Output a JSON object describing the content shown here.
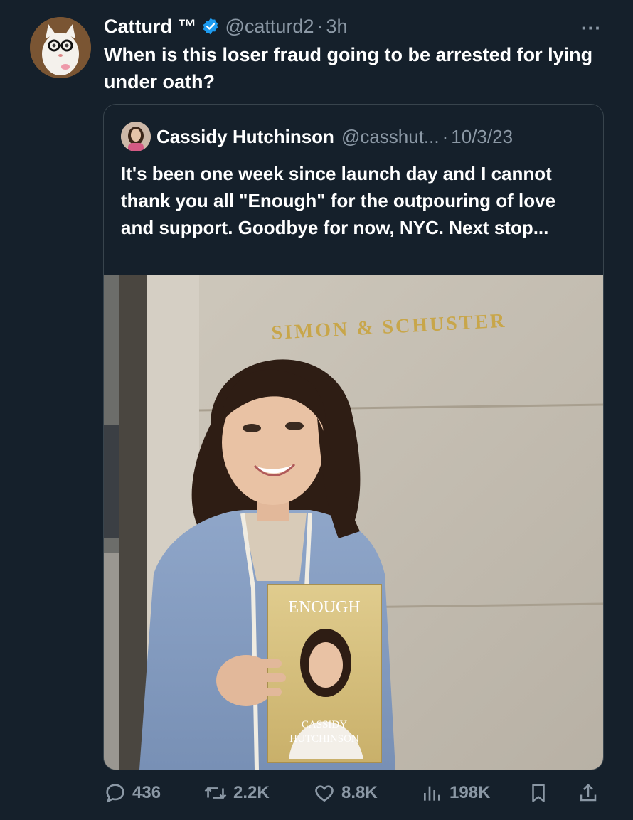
{
  "tweet": {
    "author": {
      "display_name": "Catturd ™",
      "handle": "@catturd2",
      "separator": "·",
      "time": "3h"
    },
    "text": "When is this loser fraud going to be arrested for lying under oath?",
    "more_label": "···"
  },
  "quote": {
    "author": {
      "display_name": "Cassidy Hutchinson",
      "handle": "@casshut...",
      "separator": "·",
      "time": "10/3/23"
    },
    "text": "It's been one week since launch day and I cannot thank you all \"Enough\" for the outpouring of love and support. Goodbye for now, NYC. Next stop...",
    "photo": {
      "sign_text": "SIMON & SCHUSTER",
      "book_title": "ENOUGH",
      "book_author_line1": "CASSIDY",
      "book_author_line2": "HUTCHINSON"
    }
  },
  "actions": {
    "replies": "436",
    "reposts": "2.2K",
    "likes": "8.8K",
    "views": "198K"
  },
  "icons": {
    "verified": "verified-badge-icon",
    "reply": "reply-icon",
    "repost": "repost-icon",
    "like": "heart-icon",
    "views": "views-icon",
    "bookmark": "bookmark-icon",
    "share": "share-icon"
  },
  "colors": {
    "background": "#15202b",
    "secondary_text": "#8b98a5",
    "verified_blue": "#1d9bf0",
    "border": "#38444d"
  }
}
